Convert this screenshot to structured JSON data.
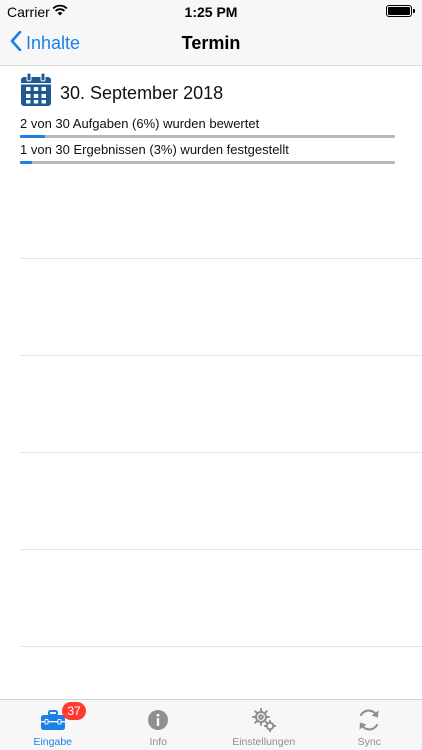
{
  "status_bar": {
    "carrier": "Carrier",
    "time": "1:25 PM",
    "wifi_icon": "wifi-icon",
    "battery_icon": "battery-icon"
  },
  "nav": {
    "back_label": "Inhalte",
    "back_icon": "chevron-left-icon",
    "title": "Termin"
  },
  "appointment": {
    "calendar_icon": "calendar-icon",
    "date": "30. September 2018",
    "stats": [
      {
        "label": "2 von 30 Aufgaben (6%) wurden bewertet",
        "progress": 0.0667
      },
      {
        "label": "1 von 30 Ergebnissen (3%) wurden festgestellt",
        "progress": 0.0333
      }
    ]
  },
  "tabs": [
    {
      "label": "Eingabe",
      "icon": "toolbox-icon",
      "active": true,
      "badge": "37"
    },
    {
      "label": "Info",
      "icon": "info-icon",
      "active": false
    },
    {
      "label": "Einstellungen",
      "icon": "gears-icon",
      "active": false
    },
    {
      "label": "Sync",
      "icon": "sync-icon",
      "active": false
    }
  ],
  "colors": {
    "accent": "#1a7fe8",
    "calendar": "#1d5a95",
    "badge": "#ff3b30",
    "inactive": "#8e8e93"
  }
}
